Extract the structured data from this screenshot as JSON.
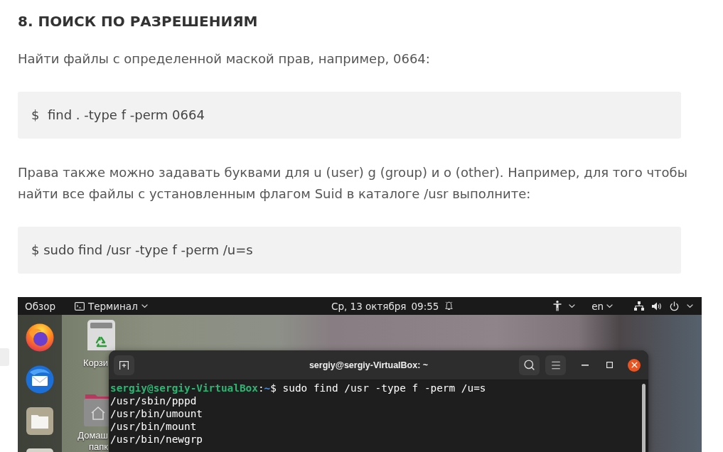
{
  "article": {
    "heading": "8. ПОИСК ПО РАЗРЕШЕНИЯМ",
    "blocks": [
      {
        "kind": "paragraph",
        "text": "Найти файлы с определенной маской прав, например, 0664:"
      },
      {
        "kind": "code",
        "text": "$  find . -type f -perm 0664"
      },
      {
        "kind": "paragraph",
        "text": "Права также можно задавать буквами для u (user) g (group) и o (other). Например, для того чтобы найти все файлы с установленным флагом Suid в каталоге /usr выполните:"
      },
      {
        "kind": "code",
        "text": "$ sudo find /usr -type f -perm /u=s"
      }
    ]
  },
  "screenshot": {
    "top_bar": {
      "activities": "Обзор",
      "app_menu": "Терминал",
      "date": "Ср, 13 октября",
      "time": "09:55",
      "keyboard_layout": "en"
    },
    "desktop_icons": [
      {
        "kind": "trash",
        "label_lines": [
          "Корзи"
        ]
      },
      {
        "kind": "home",
        "label_lines": [
          "Домаш",
          "папк"
        ]
      }
    ],
    "terminal": {
      "title": "sergiy@sergiy-VirtualBox: ~",
      "prompt": {
        "user_host": "sergiy@sergiy-VirtualBox",
        "separator": ":",
        "path": "~",
        "command": "$ sudo find /usr -type f -perm /u=s"
      },
      "output": [
        "/usr/sbin/pppd",
        "/usr/bin/umount",
        "/usr/bin/mount",
        "/usr/bin/newgrp"
      ]
    }
  }
}
